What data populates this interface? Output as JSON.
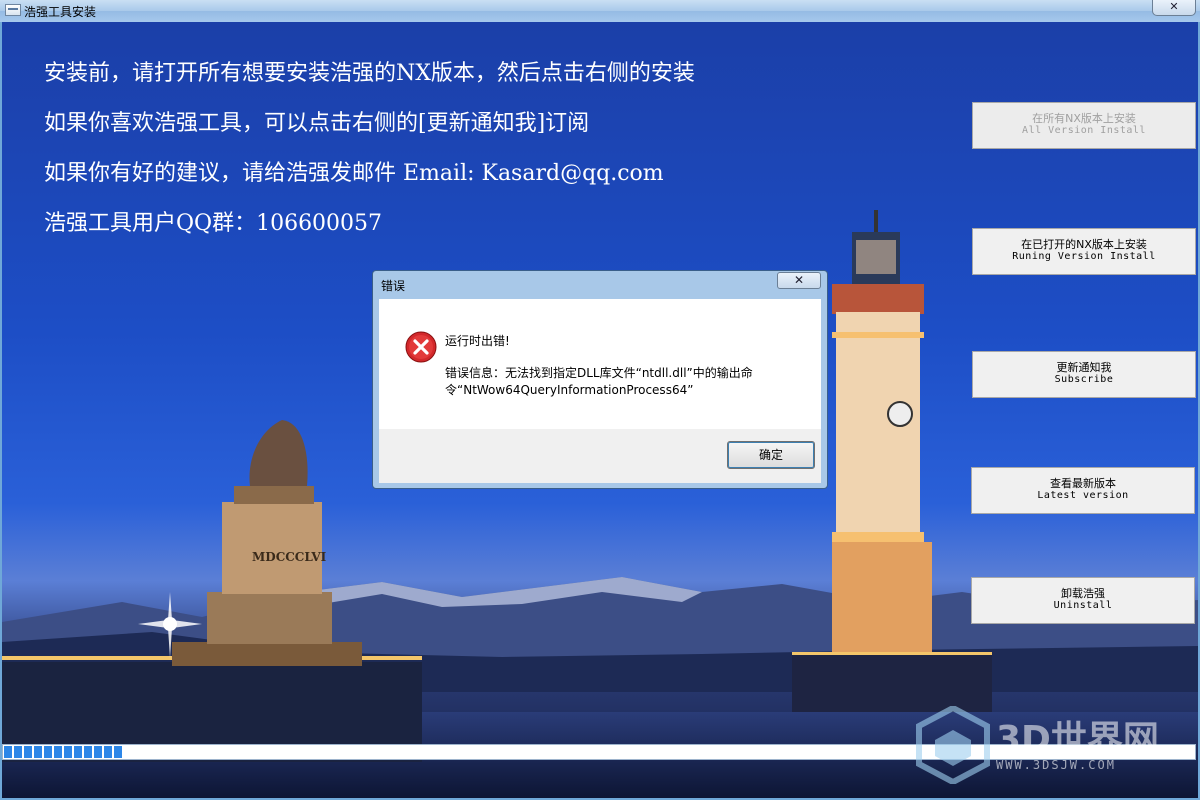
{
  "window": {
    "title": "浩强工具安装",
    "close_label": "✕"
  },
  "info_lines": [
    "安装前，请打开所有想要安装浩强的NX版本，然后点击右侧的安装",
    "如果你喜欢浩强工具，可以点击右侧的[更新通知我]订阅",
    "如果你有好的建议，请给浩强发邮件 Email: Kasard@qq.com",
    "浩强工具用户QQ群：106600057"
  ],
  "buttons": [
    {
      "zh": "在所有NX版本上安装",
      "en": "All Version Install",
      "enabled": false
    },
    {
      "zh": "在已打开的NX版本上安装",
      "en": "Runing Version Install",
      "enabled": true
    },
    {
      "zh": "更新通知我",
      "en": "Subscribe",
      "enabled": true
    },
    {
      "zh": "查看最新版本",
      "en": "Latest version",
      "enabled": true
    },
    {
      "zh": "卸载浩强",
      "en": "Uninstall",
      "enabled": true
    }
  ],
  "progress": {
    "value_fraction": 0.1
  },
  "dialog": {
    "title": "错误",
    "close_label": "✕",
    "heading": "运行时出错!",
    "message": "错误信息：无法找到指定DLL库文件“ntdll.dll”中的输出命令“NtWow64QueryInformationProcess64”",
    "ok_label": "确定"
  },
  "scene": {
    "monument_inscription": "MDCCCLVI"
  },
  "watermark": {
    "title": "3D世界网",
    "url": "WWW.3DSJW.COM"
  },
  "colors": {
    "sky": "#1d4ec6",
    "error_red": "#d2282b",
    "progress_fill": "#2c86e8"
  }
}
